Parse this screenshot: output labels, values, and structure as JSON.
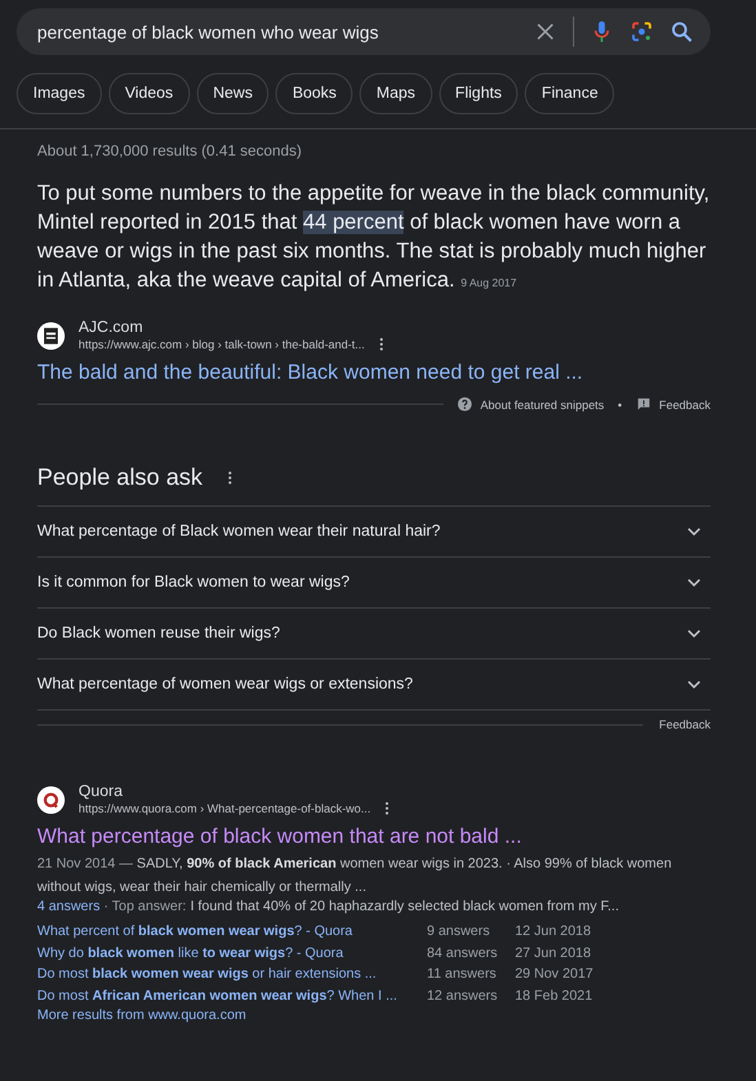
{
  "search": {
    "value": "percentage of black women who wear wigs"
  },
  "chips": [
    {
      "label": "Images",
      "selected": false
    },
    {
      "label": "Videos",
      "selected": false
    },
    {
      "label": "News",
      "selected": false
    },
    {
      "label": "Books",
      "selected": false
    },
    {
      "label": "Maps",
      "selected": false
    },
    {
      "label": "Flights",
      "selected": false
    },
    {
      "label": "Finance",
      "selected": false
    }
  ],
  "result_stats": "About 1,730,000 results (0.41 seconds)",
  "featured_snippet": {
    "text_before": "To put some numbers to the appetite for weave in the black community, Mintel reported in 2015 that ",
    "highlight": "44 percent",
    "text_after": " of black women have worn a weave or wigs in the past six months. The stat is probably much higher in Atlanta, aka the weave capital of America.",
    "date": "9 Aug 2017",
    "source": {
      "name": "AJC.com",
      "url": "https://www.ajc.com › blog › talk-town › the-bald-and-t..."
    },
    "title": "The bald and the beautiful: Black women need to get real ...",
    "about": "About featured snippets",
    "separator": "•",
    "feedback": "Feedback"
  },
  "people_also_ask": {
    "heading": "People also ask",
    "questions": [
      {
        "text": "What percentage of Black women wear their natural hair?",
        "expanded": false
      },
      {
        "text": "Is it common for Black women to wear wigs?",
        "expanded": false
      },
      {
        "text": "Do Black women reuse their wigs?",
        "expanded": false
      },
      {
        "text": "What percentage of women wear wigs or extensions?",
        "expanded": false
      }
    ],
    "feedback": "Feedback"
  },
  "result": {
    "source": {
      "name": "Quora",
      "url": "https://www.quora.com › What-percentage-of-black-wo..."
    },
    "title": "What percentage of black women that are not bald ...",
    "date": "21 Nov 2014 —",
    "snippet": "SADLY, **90% of black American** women wear wigs in 2023. · Also 99% of black women without wigs, wear their hair chemically or thermally ...",
    "answers_link": "4 answers",
    "top_answer_label": "· Top answer:",
    "top_answer": "I found that 40% of 20 haphazardly selected black women from my F...",
    "related": [
      {
        "title": "What percent of **black women wear wigs**? - Quora",
        "answers": "9 answers",
        "date": "12 Jun 2018"
      },
      {
        "title": "Why do **black women** like **to wear wigs**? - Quora",
        "answers": "84 answers",
        "date": "27 Jun 2018"
      },
      {
        "title": "Do most **black women wear wigs** or hair extensions ...",
        "answers": "11 answers",
        "date": "29 Nov 2017"
      },
      {
        "title": "Do most **African American women wear wigs**? When I ...",
        "answers": "12 answers",
        "date": "18 Feb 2021"
      }
    ],
    "more": "More results from www.quora.com"
  }
}
